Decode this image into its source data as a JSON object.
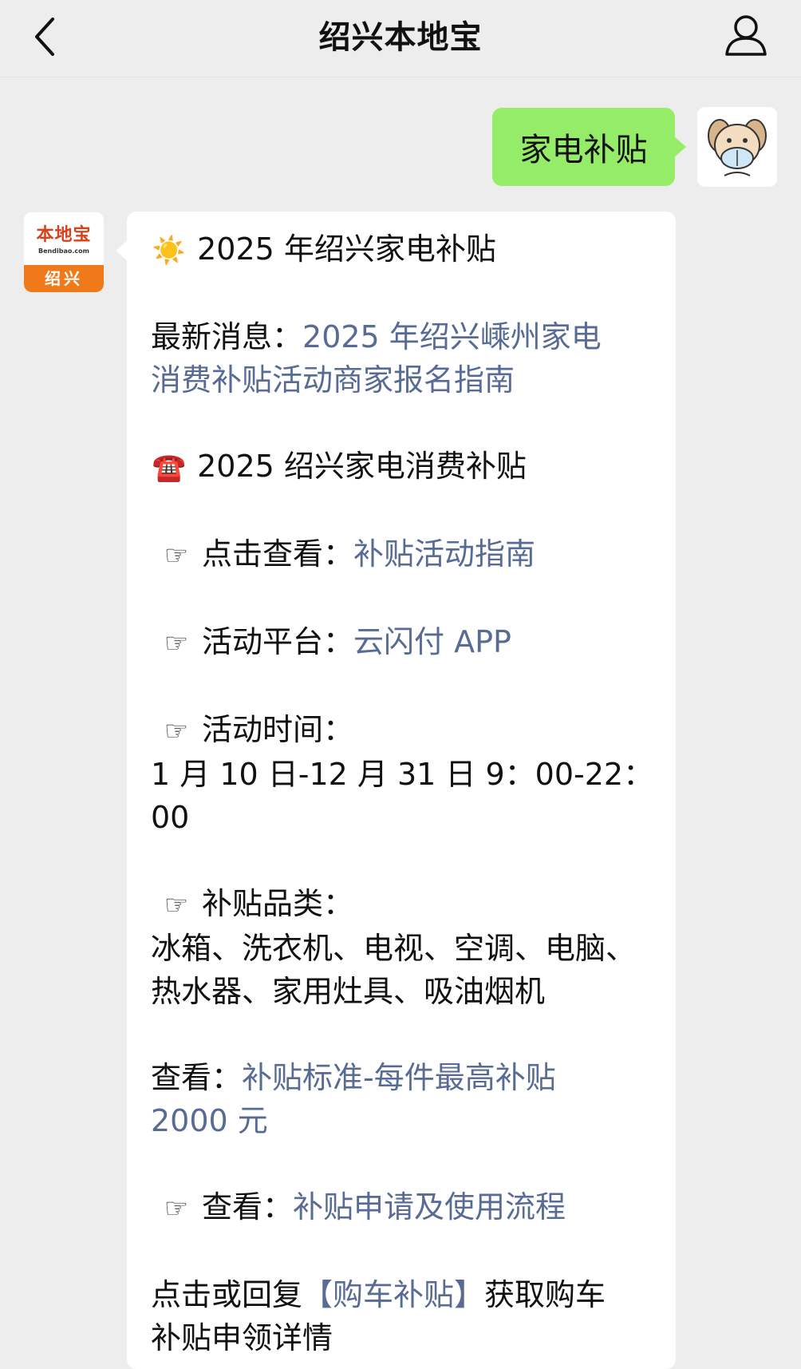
{
  "header": {
    "title": "绍兴本地宝"
  },
  "user_message": {
    "text": "家电补贴"
  },
  "bot_avatar": {
    "brand": "本地宝",
    "url": "Bendibao.com",
    "city": "绍兴"
  },
  "message": {
    "heading_emoji": "☀️",
    "heading": "2025 年绍兴家电补贴",
    "latest_label": "最新消息：",
    "latest_link_line1": "2025 年绍兴嵊州家电",
    "latest_link_line2": "消费补贴活动商家报名指南",
    "section_emoji": "☎️",
    "section_title": "2025 绍兴家电消费补贴",
    "hand": "☞",
    "view_label": "点击查看：",
    "view_link": "补贴活动指南",
    "platform_label": "活动平台：",
    "platform_link": "云闪付 APP",
    "time_label": "活动时间：",
    "time_line1": "1 月 10 日-12 月 31 日 9：00-22：",
    "time_line2": "00",
    "category_label": "补贴品类：",
    "category_line1": "冰箱、洗衣机、电视、空调、电脑、",
    "category_line2": "热水器、家用灶具、吸油烟机",
    "standard_label": "查看：",
    "standard_link_line1": "补贴标准-每件最高补贴",
    "standard_link_line2": "2000 元",
    "process_label": "查看：",
    "process_link": "补贴申请及使用流程",
    "car_prefix": "点击或回复",
    "car_link": "【购车补贴】",
    "car_suffix": "获取购车",
    "car_line2": "补贴申领详情"
  }
}
